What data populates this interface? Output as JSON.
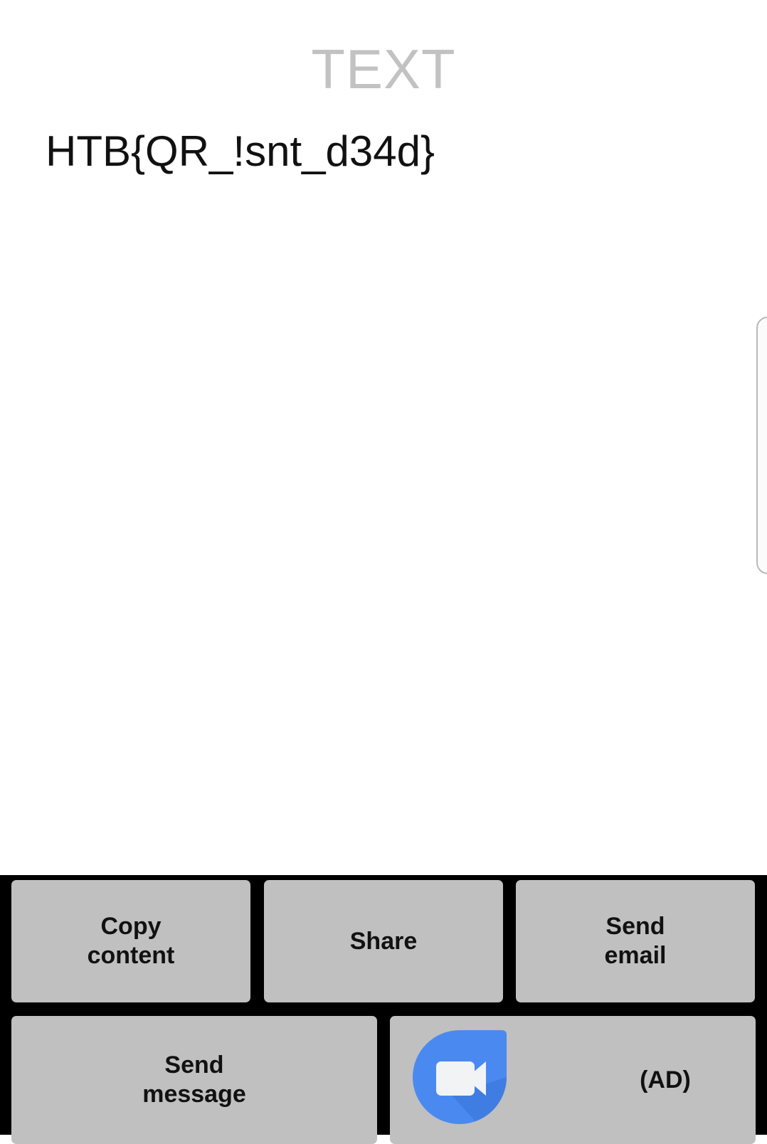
{
  "header": {
    "title": "TEXT"
  },
  "result": {
    "text": "HTB{QR_!snt_d34d}"
  },
  "actions": {
    "copy": "Copy\ncontent",
    "share": "Share",
    "email": "Send\nemail",
    "message": "Send\nmessage",
    "ad": "(AD)"
  },
  "colors": {
    "ad_icon": "#4a8af0",
    "panel": "#000000",
    "button": "#c0c0c0"
  }
}
